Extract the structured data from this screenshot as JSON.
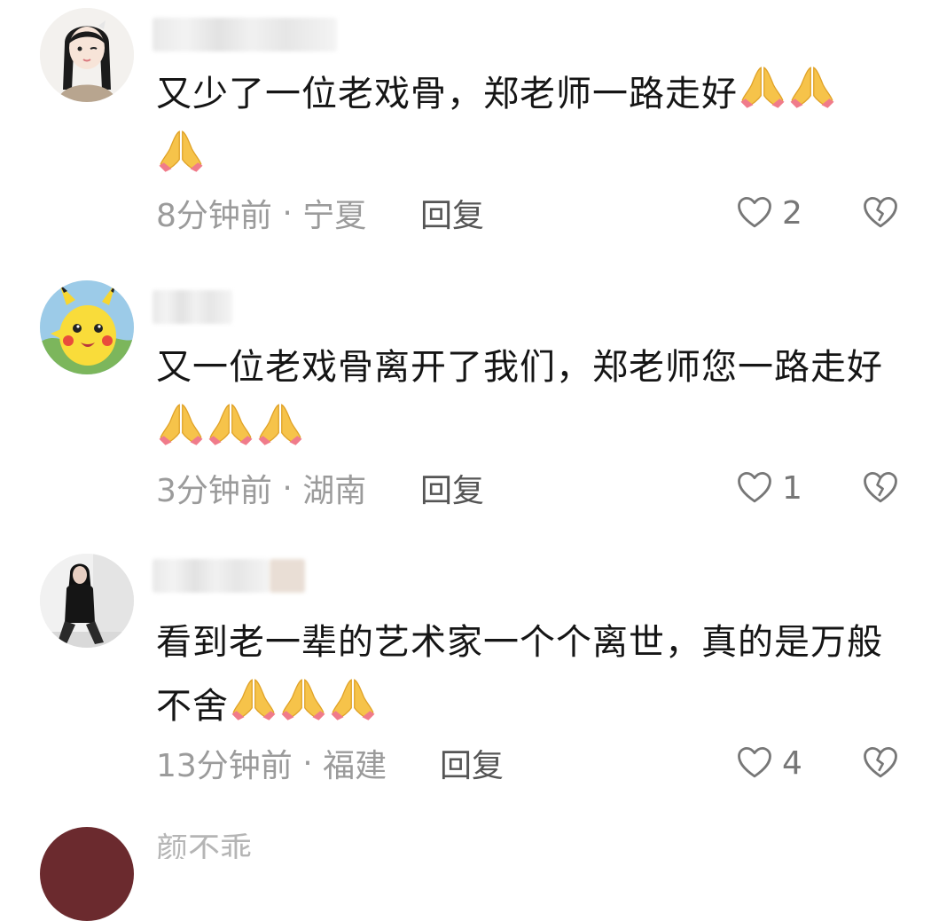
{
  "comments": [
    {
      "text": "又少了一位老戏骨，郑老师一路走好",
      "emoji_count": 3,
      "time": "8分钟前",
      "location": "宁夏",
      "reply_label": "回复",
      "likes": "2",
      "avatar": "girl-avatar"
    },
    {
      "text": "又一位老戏骨离开了我们，郑老师您一路走好",
      "emoji_count": 3,
      "time": "3分钟前",
      "location": "湖南",
      "reply_label": "回复",
      "likes": "1",
      "avatar": "pikachu-avatar"
    },
    {
      "text": "看到老一辈的艺术家一个个离世，真的是万般不舍",
      "emoji_count": 3,
      "time": "13分钟前",
      "location": "福建",
      "reply_label": "回复",
      "likes": "4",
      "avatar": "woman-photo-avatar"
    }
  ],
  "partial_comment": {
    "username": "颜不乖"
  },
  "icons": {
    "emoji": "folded-hands-emoji",
    "like": "heart-outline-icon",
    "dislike": "broken-heart-icon"
  },
  "colors": {
    "text": "#151515",
    "meta": "#9b9b9b",
    "reply": "#555555",
    "icon": "#777777"
  }
}
